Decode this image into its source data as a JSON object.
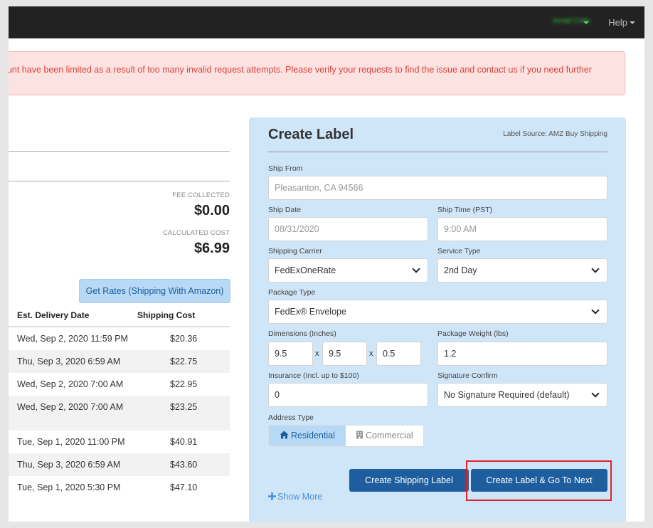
{
  "header": {
    "user_name": "Ismail Corlu",
    "help_label": "Help"
  },
  "alert": {
    "message": "ount have been limited as a result of too many invalid request attempts. Please verify your requests to find the issue and contact us if you need further"
  },
  "summary": {
    "fee_collected_label": "FEE COLLECTED",
    "fee_collected_value": "$0.00",
    "calculated_cost_label": "CALCULATED COST",
    "calculated_cost_value": "$6.99"
  },
  "rates": {
    "get_rates_label": "Get Rates (Shipping With Amazon)",
    "columns": [
      "Est. Delivery Date",
      "Shipping Cost"
    ],
    "rows": [
      {
        "date": "Wed, Sep 2, 2020 11:59 PM",
        "cost": "$20.36"
      },
      {
        "date": "Thu, Sep 3, 2020 6:59 AM",
        "cost": "$22.75"
      },
      {
        "date": "Wed, Sep 2, 2020 7:00 AM",
        "cost": "$22.95"
      },
      {
        "date": "Wed, Sep 2, 2020 7:00 AM",
        "cost": "$23.25"
      },
      {
        "date": "Tue, Sep 1, 2020 11:00 PM",
        "cost": "$40.91"
      },
      {
        "date": "Thu, Sep 3, 2020 6:59 AM",
        "cost": "$43.60"
      },
      {
        "date": "Tue, Sep 1, 2020 5:30 PM",
        "cost": "$47.10"
      }
    ]
  },
  "create_label": {
    "title": "Create Label",
    "label_source": "Label Source: AMZ Buy Shipping",
    "ship_from_label": "Ship From",
    "ship_from_placeholder": "Pleasanton, CA 94566",
    "ship_date_label": "Ship Date",
    "ship_date_placeholder": "08/31/2020",
    "ship_time_label": "Ship Time (PST)",
    "ship_time_placeholder": "9:00 AM",
    "carrier_label": "Shipping Carrier",
    "carrier_value": "FedExOneRate",
    "service_label": "Service Type",
    "service_value": "2nd Day",
    "package_label": "Package Type",
    "package_value": "FedEx® Envelope",
    "dimensions_label": "Dimensions (Inches)",
    "dim_length": "9.5",
    "dim_width": "9.5",
    "dim_height": "0.5",
    "dim_separator": "x",
    "weight_label": "Package Weight (lbs)",
    "weight_value": "1.2",
    "insurance_label": "Insurance (Incl. up to $100)",
    "insurance_value": "0",
    "signature_label": "Signature Confirm",
    "signature_value": "No Signature Required (default)",
    "address_type_label": "Address Type",
    "residential_label": "Residential",
    "commercial_label": "Commercial",
    "create_button": "Create Shipping Label",
    "create_next_button": "Create Label & Go To Next",
    "show_more": "Show More"
  },
  "colors": {
    "accent": "#1f5e9e",
    "panel_bg": "#cfe5f8",
    "alert_text": "#d9423b",
    "highlight": "#e3202a"
  }
}
